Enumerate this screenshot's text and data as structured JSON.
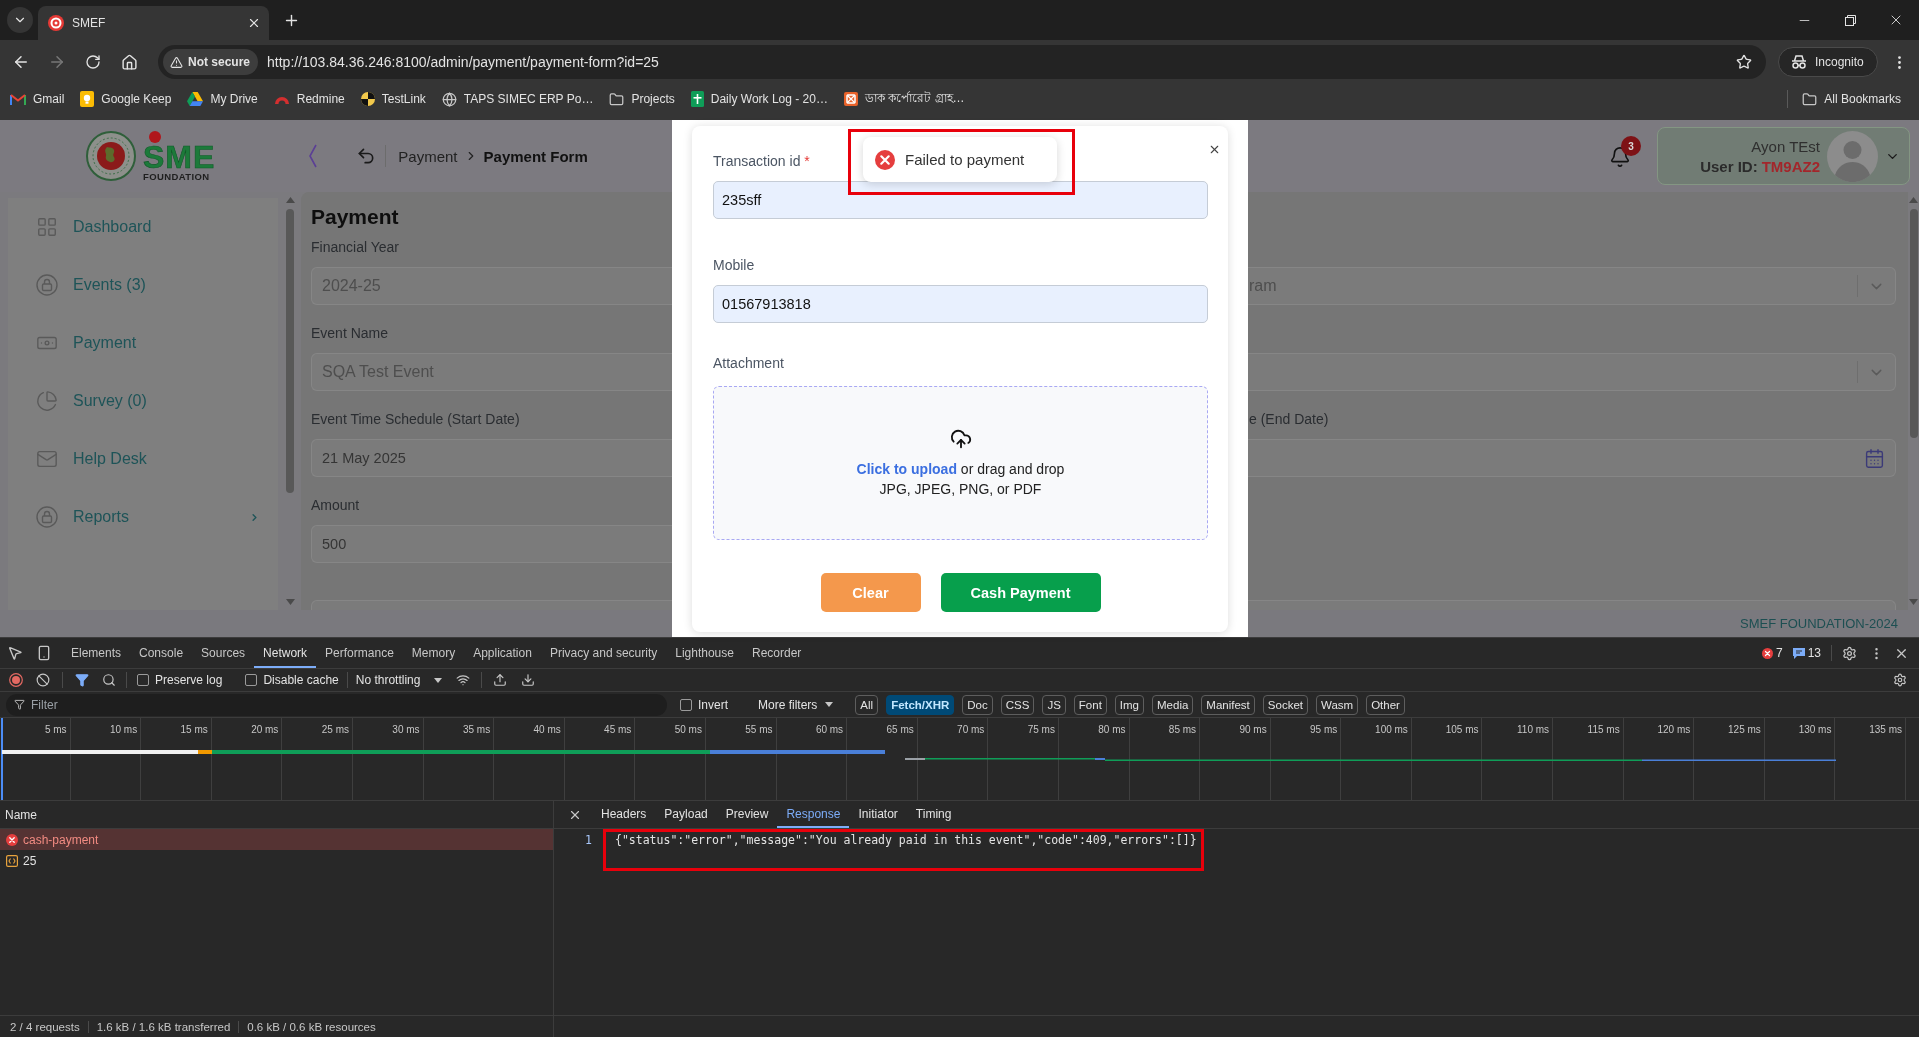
{
  "browser": {
    "tabs": [
      {
        "title": "SMEF",
        "selected": true
      }
    ],
    "forward_disabled": true,
    "address": {
      "security": "Not secure",
      "url": "http://103.84.36.246:8100/admin/payment/payment-form?id=25"
    },
    "profile": "Incognito",
    "bookmarks": [
      {
        "label": "Gmail",
        "kind": "site"
      },
      {
        "label": "Google Keep",
        "kind": "site"
      },
      {
        "label": "My Drive",
        "kind": "site"
      },
      {
        "label": "Redmine",
        "kind": "site"
      },
      {
        "label": "TestLink",
        "kind": "site"
      },
      {
        "label": "TAPS SIMEC ERP Po…",
        "kind": "site"
      },
      {
        "label": "Projects",
        "kind": "folder"
      },
      {
        "label": "Daily Work Log - 20…",
        "kind": "site"
      },
      {
        "label": "ডাক কর্পোরেট গ্রাহ…",
        "kind": "site"
      }
    ],
    "all_bookmarks": "All Bookmarks"
  },
  "app": {
    "logo": {
      "mark": "SME",
      "caption": "FOUNDATION"
    },
    "breadcrumb": [
      {
        "label": "Payment",
        "current": false
      },
      {
        "label": "Payment Form",
        "current": true
      }
    ],
    "notifications": "3",
    "user": {
      "name": "Ayon TEst",
      "id_label": "User ID:",
      "id": "TM9AZ2"
    },
    "sidebar": [
      {
        "label": "Dashboard",
        "expandable": false
      },
      {
        "label": "Events (3)",
        "expandable": false
      },
      {
        "label": "Payment",
        "expandable": false
      },
      {
        "label": "Survey (0)",
        "expandable": false
      },
      {
        "label": "Help Desk",
        "expandable": false
      },
      {
        "label": "Reports",
        "expandable": true
      }
    ],
    "form": {
      "title": "Payment",
      "rows": [
        {
          "left": {
            "label": "Financial Year",
            "value": "2024-25",
            "kind": "select"
          },
          "right": {
            "value": "ram",
            "kind": "select"
          }
        },
        {
          "left": {
            "label": "Event Name",
            "value": "SQA Test Event",
            "kind": "select"
          },
          "right": {
            "kind": "select"
          }
        },
        {
          "left": {
            "label": "Event Time Schedule (Start Date)",
            "value": "21 May 2025",
            "kind": "date"
          },
          "right": {
            "label": "e (End Date)",
            "kind": "date"
          }
        },
        {
          "left": {
            "label": "Amount",
            "value": "500",
            "kind": "text"
          }
        },
        {
          "left": {
            "kind": "text"
          },
          "right": {
            "kind": "text"
          }
        }
      ]
    },
    "footer": "SMEF FOUNDATION-2024"
  },
  "modal": {
    "fields": [
      {
        "label": "Transaction id",
        "required_mark": "*",
        "value": "235sff"
      },
      {
        "label": "Mobile",
        "value": "01567913818"
      }
    ],
    "attachment": {
      "label": "Attachment",
      "link": "Click to upload",
      "hint": "or drag and drop",
      "formats": "JPG, JPEG, PNG, or PDF"
    },
    "buttons": [
      {
        "label": "Clear",
        "kind": "reset"
      },
      {
        "label": "Cash Payment",
        "kind": "submit"
      }
    ]
  },
  "toast": {
    "message": "Failed to payment",
    "kind": "error"
  },
  "devtools": {
    "panels": [
      {
        "label": "Elements",
        "selected": false
      },
      {
        "label": "Console",
        "selected": false
      },
      {
        "label": "Sources",
        "selected": false
      },
      {
        "label": "Network",
        "selected": true
      },
      {
        "label": "Performance",
        "selected": false
      },
      {
        "label": "Memory",
        "selected": false
      },
      {
        "label": "Application",
        "selected": false
      },
      {
        "label": "Privacy and security",
        "selected": false
      },
      {
        "label": "Lighthouse",
        "selected": false
      },
      {
        "label": "Recorder",
        "selected": false
      }
    ],
    "issues": {
      "errors": "7",
      "messages": "13"
    },
    "toolbar": {
      "recording": true,
      "options": [
        {
          "label": "Preserve log",
          "checked": false
        },
        {
          "label": "Disable cache",
          "checked": false
        }
      ],
      "throttling": "No throttling"
    },
    "filter": {
      "placeholder": "Filter",
      "invert": {
        "label": "Invert",
        "checked": false
      },
      "more_filters": "More filters",
      "types": [
        {
          "label": "All",
          "selected": false
        },
        {
          "label": "Fetch/XHR",
          "selected": true
        },
        {
          "label": "Doc",
          "selected": false
        },
        {
          "label": "CSS",
          "selected": false
        },
        {
          "label": "JS",
          "selected": false
        },
        {
          "label": "Font",
          "selected": false
        },
        {
          "label": "Img",
          "selected": false
        },
        {
          "label": "Media",
          "selected": false
        },
        {
          "label": "Manifest",
          "selected": false
        },
        {
          "label": "Socket",
          "selected": false
        },
        {
          "label": "Wasm",
          "selected": false
        },
        {
          "label": "Other",
          "selected": false
        }
      ]
    },
    "timeline": {
      "ticks": [
        "5 ms",
        "10 ms",
        "15 ms",
        "20 ms",
        "25 ms",
        "30 ms",
        "35 ms",
        "40 ms",
        "45 ms",
        "50 ms",
        "55 ms",
        "60 ms",
        "65 ms",
        "70 ms",
        "75 ms",
        "80 ms",
        "85 ms",
        "90 ms",
        "95 ms",
        "100 ms",
        "105 ms",
        "110 ms",
        "115 ms",
        "120 ms",
        "125 ms",
        "130 ms",
        "135 ms"
      ]
    },
    "requests": {
      "column": "Name",
      "rows": [
        {
          "name": "cash-payment",
          "kind": "error",
          "selected": true
        },
        {
          "name": "25",
          "kind": "document",
          "selected": false
        }
      ]
    },
    "detail": {
      "tabs": [
        {
          "label": "Headers",
          "selected": false
        },
        {
          "label": "Payload",
          "selected": false
        },
        {
          "label": "Preview",
          "selected": false
        },
        {
          "label": "Response",
          "selected": true
        },
        {
          "label": "Initiator",
          "selected": false
        },
        {
          "label": "Timing",
          "selected": false
        }
      ],
      "lines": [
        {
          "number": "1",
          "text": "{\"status\":\"error\",\"message\":\"You already paid in this event\",\"code\":409,\"errors\":[]}"
        }
      ]
    },
    "status_bar": [
      "2 / 4 requests",
      "1.6 kB / 1.6 kB transferred",
      "0.6 kB / 0.6 kB resources"
    ]
  }
}
